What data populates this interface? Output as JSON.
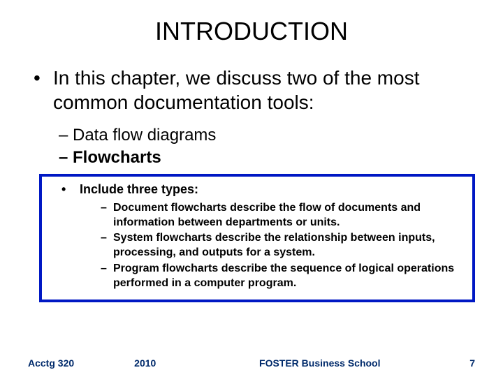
{
  "title": "INTRODUCTION",
  "lead": "In this chapter, we discuss two of the most common documentation tools:",
  "tools": [
    "Data flow diagrams",
    "Flowcharts"
  ],
  "box": {
    "heading": "Include three types:",
    "items": [
      {
        "term": "Document flowcharts",
        "desc": " describe the flow of documents and information between departments or units."
      },
      {
        "term": "System flowcharts",
        "desc": " describe the relationship between inputs, processing, and outputs for a system."
      },
      {
        "term": "Program flowcharts",
        "desc": " describe the sequence of logical operations performed in a computer program."
      }
    ]
  },
  "footer": {
    "course": "Acctg 320",
    "year": "2010",
    "school": "FOSTER Business School",
    "page": "7"
  }
}
